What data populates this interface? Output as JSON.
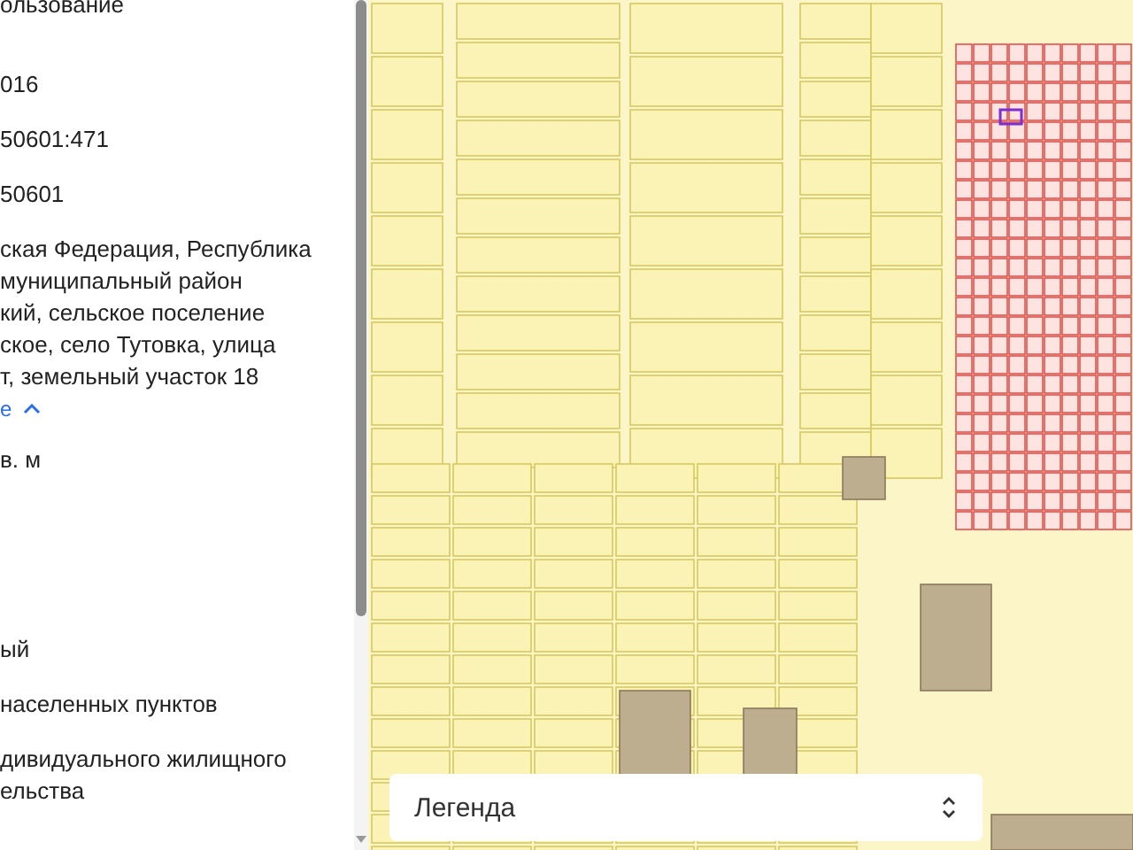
{
  "panel": {
    "lines": [
      {
        "kind": "text",
        "text": "ользование"
      },
      {
        "kind": "text",
        "text": "016"
      },
      {
        "kind": "text",
        "text": "50601:471"
      },
      {
        "kind": "text",
        "text": "50601"
      },
      {
        "kind": "text",
        "text": "ская Федерация, Республика\nмуниципальный район\nкий, сельское поселение\nское, село Тутовка, улица\nт, земельный участок 18"
      },
      {
        "kind": "link",
        "text": "е"
      },
      {
        "kind": "text",
        "text": "в. м"
      },
      {
        "kind": "gap"
      },
      {
        "kind": "text",
        "text": "ый"
      },
      {
        "kind": "text",
        "text": "населенных пунктов"
      },
      {
        "kind": "text",
        "text": "дивидуального жилищного\nельства"
      }
    ]
  },
  "map": {
    "legend": {
      "label": "Легенда"
    }
  }
}
